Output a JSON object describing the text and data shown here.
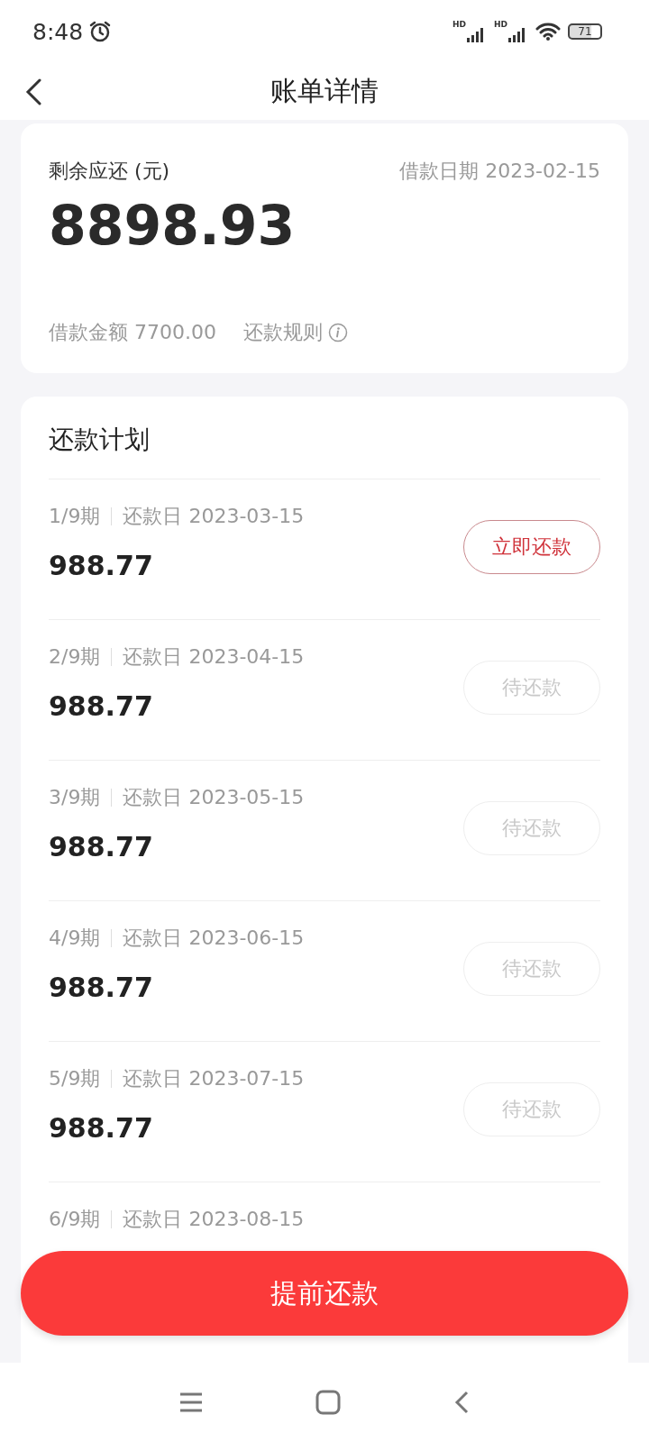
{
  "status_bar": {
    "time": "8:48",
    "signal_1": "HD",
    "signal_2": "HD",
    "battery": "71"
  },
  "header": {
    "title": "账单详情"
  },
  "summary": {
    "remaining_label": "剩余应还 (元)",
    "loan_date_label": "借款日期",
    "loan_date": "2023-02-15",
    "remaining_amount": "8898.93",
    "loan_amount_label": "借款金额",
    "loan_amount": "7700.00",
    "rules_link": "还款规则"
  },
  "plan": {
    "title": "还款计划",
    "rows": [
      {
        "period": "1/9期",
        "date_label": "还款日",
        "date": "2023-03-15",
        "amount": "988.77",
        "action": {
          "label": "立即还款",
          "kind": "pay"
        }
      },
      {
        "period": "2/9期",
        "date_label": "还款日",
        "date": "2023-04-15",
        "amount": "988.77",
        "action": {
          "label": "待还款",
          "kind": "pending"
        }
      },
      {
        "period": "3/9期",
        "date_label": "还款日",
        "date": "2023-05-15",
        "amount": "988.77",
        "action": {
          "label": "待还款",
          "kind": "pending"
        }
      },
      {
        "period": "4/9期",
        "date_label": "还款日",
        "date": "2023-06-15",
        "amount": "988.77",
        "action": {
          "label": "待还款",
          "kind": "pending"
        }
      },
      {
        "period": "5/9期",
        "date_label": "还款日",
        "date": "2023-07-15",
        "amount": "988.77",
        "action": {
          "label": "待还款",
          "kind": "pending"
        }
      },
      {
        "period": "6/9期",
        "date_label": "还款日",
        "date": "2023-08-15"
      }
    ]
  },
  "prepay_button": "提前还款"
}
